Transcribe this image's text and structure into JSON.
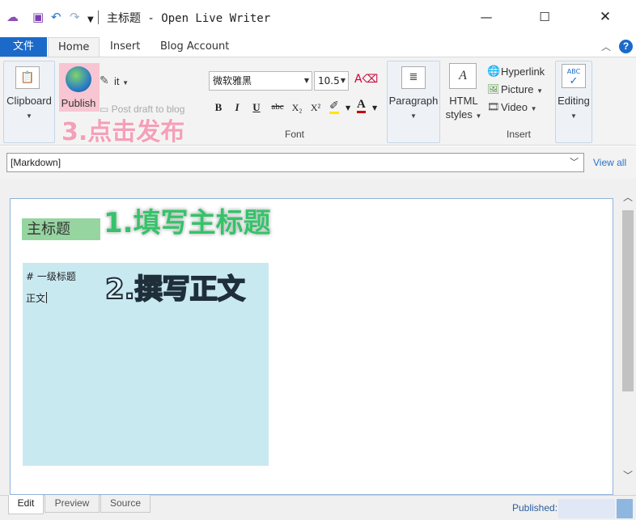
{
  "window": {
    "title": "主标题 - Open Live Writer"
  },
  "quick_access": {
    "icons": [
      "sync-icon",
      "save-icon",
      "undo-icon",
      "redo-icon",
      "customize-icon"
    ]
  },
  "tabs": {
    "file": "文件",
    "home": "Home",
    "insert": "Insert",
    "blog_account": "Blog Account"
  },
  "ribbon": {
    "clipboard": "Clipboard",
    "publish": "Publish",
    "edit_it": "it",
    "post_draft": "Post draft to blog",
    "font_name": "微软雅黑",
    "font_size": "10.5",
    "font_group": "Font",
    "paragraph": "Paragraph",
    "html_styles_1": "HTML",
    "html_styles_2": "styles",
    "hyperlink": "Hyperlink",
    "picture": "Picture",
    "video": "Video",
    "insert_group": "Insert",
    "editing": "Editing",
    "format_bold": "B",
    "format_italic": "I",
    "format_underline": "U",
    "format_strike": "abc",
    "format_sub": "X₂",
    "format_sup": "X²"
  },
  "category": {
    "value": "[Markdown]",
    "view_all": "View all"
  },
  "editor": {
    "title": "主标题",
    "body_line1": "# 一级标题",
    "body_line2": "正文"
  },
  "annotations": {
    "step1": "1.填写主标题",
    "step2": "2.撰写正文",
    "step3": "3.点击发布"
  },
  "bottom_tabs": {
    "edit": "Edit",
    "preview": "Preview",
    "source": "Source"
  },
  "status": {
    "published_label": "Published:"
  },
  "colors": {
    "accent": "#1b6ac9",
    "title_highlight": "#96d5a0",
    "body_highlight": "#c9e9f1",
    "publish_highlight": "#f7c6d2"
  }
}
